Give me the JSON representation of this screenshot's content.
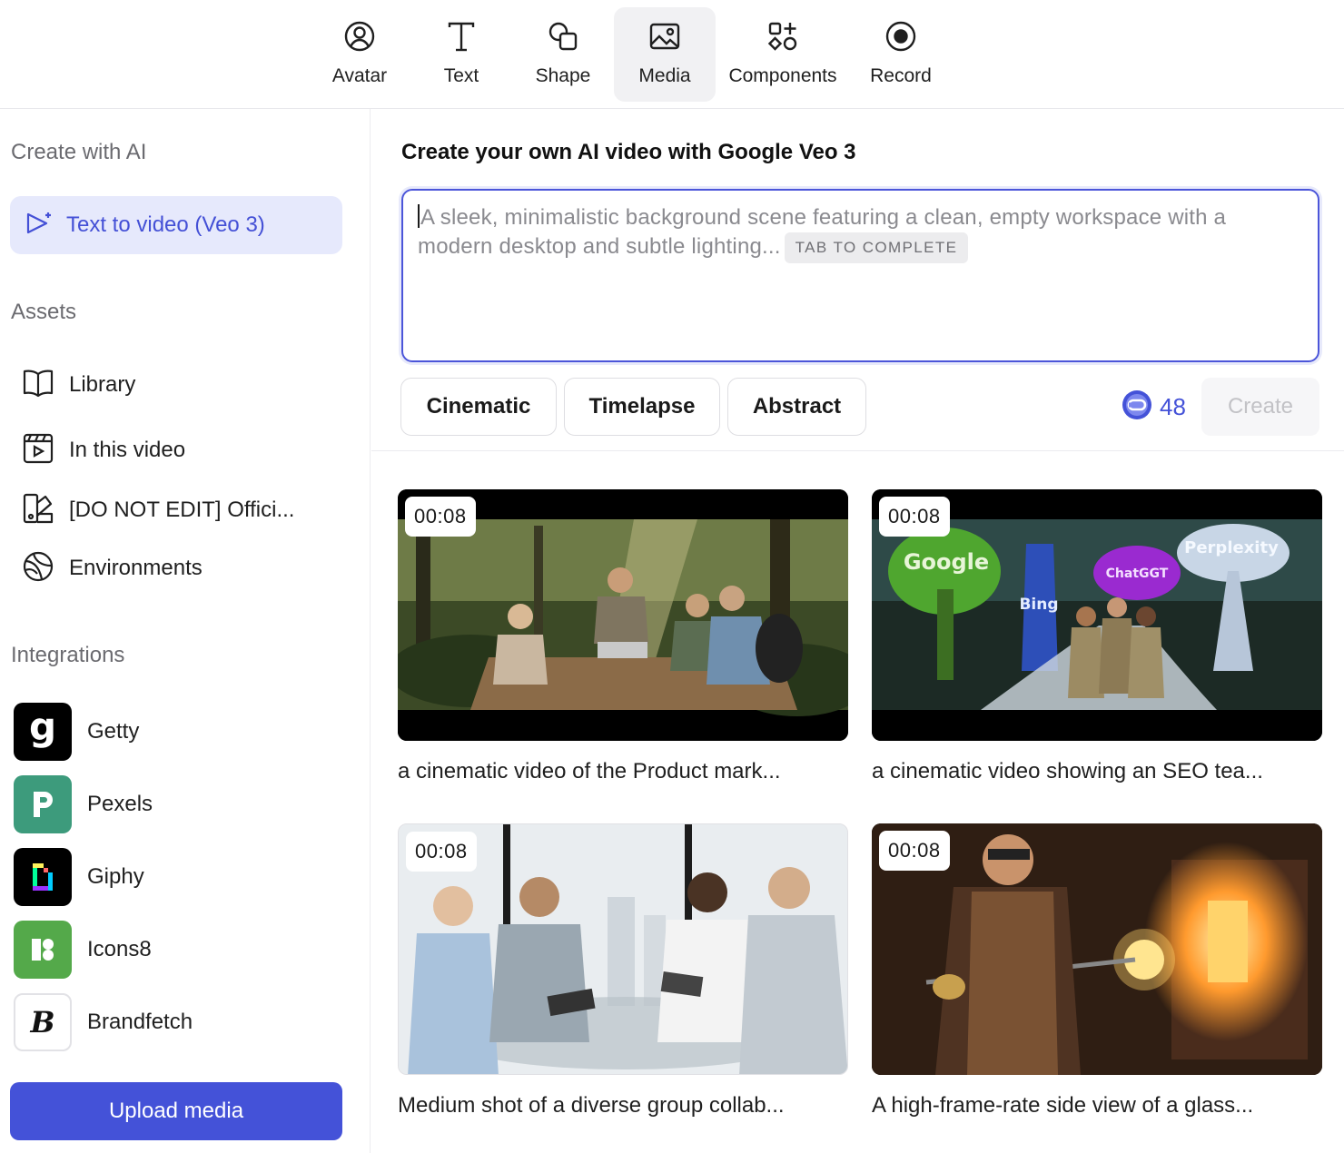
{
  "toolbar": {
    "items": [
      {
        "label": "Avatar",
        "icon": "avatar-icon"
      },
      {
        "label": "Text",
        "icon": "text-icon"
      },
      {
        "label": "Shape",
        "icon": "shape-icon"
      },
      {
        "label": "Media",
        "icon": "media-icon",
        "active": true
      },
      {
        "label": "Components",
        "icon": "components-icon"
      },
      {
        "label": "Record",
        "icon": "record-icon"
      }
    ]
  },
  "sidebar": {
    "create_title": "Create with AI",
    "text_to_video": "Text to video (Veo 3)",
    "assets_title": "Assets",
    "assets": [
      {
        "label": "Library",
        "icon": "book-icon"
      },
      {
        "label": "In this video",
        "icon": "video-frame-icon"
      },
      {
        "label": "[DO NOT EDIT] Offici...",
        "icon": "brand-kit-icon"
      },
      {
        "label": "Environments",
        "icon": "globe-icon"
      }
    ],
    "integrations_title": "Integrations",
    "integrations": [
      {
        "label": "Getty",
        "icon": "getty-logo"
      },
      {
        "label": "Pexels",
        "icon": "pexels-logo"
      },
      {
        "label": "Giphy",
        "icon": "giphy-logo"
      },
      {
        "label": "Icons8",
        "icon": "icons8-logo"
      },
      {
        "label": "Brandfetch",
        "icon": "brandfetch-logo"
      }
    ],
    "upload_label": "Upload media"
  },
  "main": {
    "title": "Create your own AI video with Google Veo 3",
    "prompt_placeholder": "A sleek, minimalistic background scene featuring a clean, empty workspace with a modern desktop and subtle lighting...",
    "tab_hint": "TAB TO COMPLETE",
    "styles": [
      "Cinematic",
      "Timelapse",
      "Abstract"
    ],
    "credits": "48",
    "create_label": "Create",
    "accent": "#4452d8"
  },
  "videos": [
    {
      "duration": "00:08",
      "caption": "a cinematic video of the Product mark..."
    },
    {
      "duration": "00:08",
      "caption": "a cinematic video showing an SEO tea..."
    },
    {
      "duration": "00:08",
      "caption": "Medium shot of a diverse group collab..."
    },
    {
      "duration": "00:08",
      "caption": "A high-frame-rate side view of a glass..."
    }
  ],
  "thumbnail_labels": {
    "google": "Google",
    "bing": "Bing",
    "chatgpt": "ChatGGT",
    "perplexity": "Perplexity"
  }
}
